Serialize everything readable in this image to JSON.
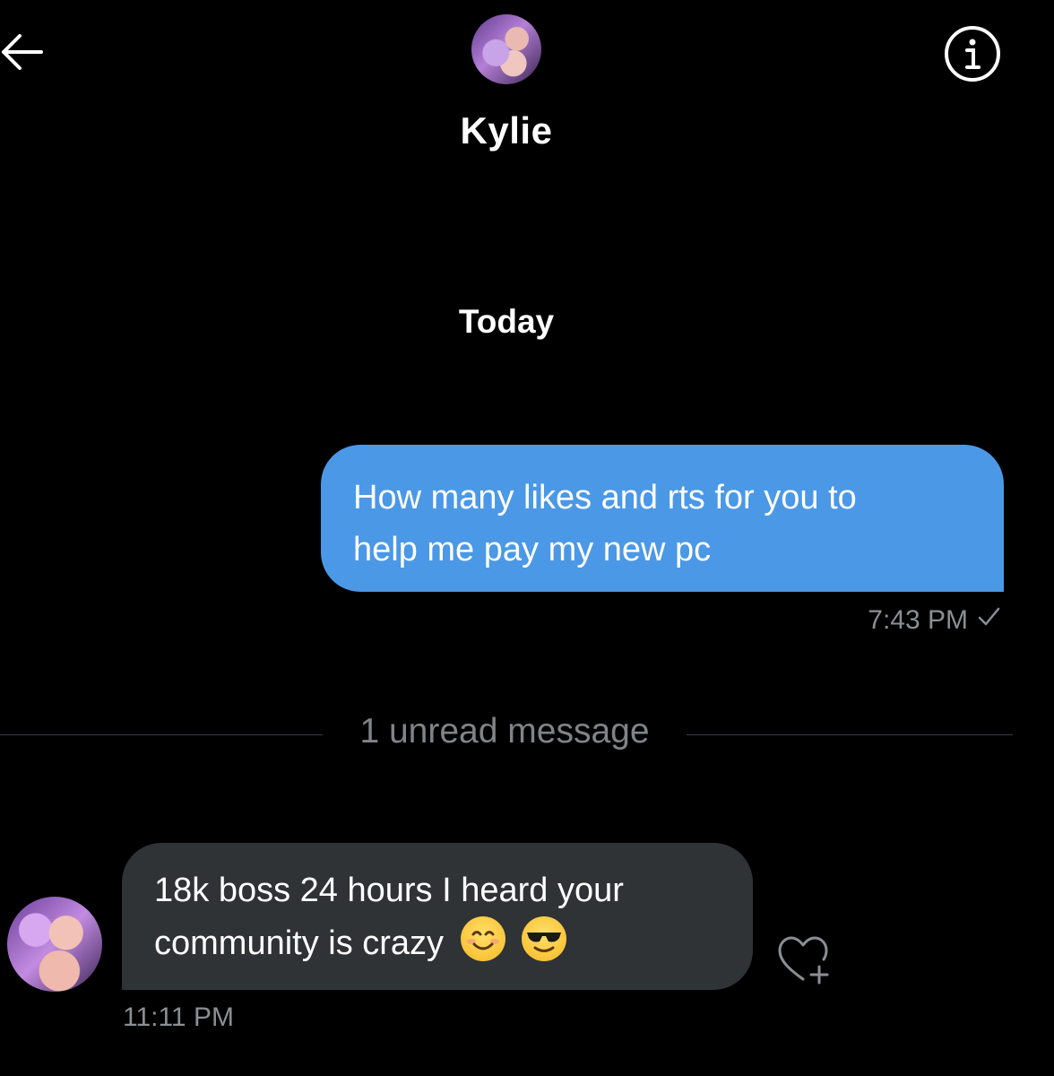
{
  "header": {
    "contact_name": "Kylie",
    "back_icon": "arrow-left-icon",
    "info_icon": "info-icon",
    "avatar": "contact-avatar"
  },
  "conversation": {
    "day_label": "Today",
    "sent_message": {
      "text_line1": "How many likes and rts for you to",
      "text_line2": "help me pay my new pc",
      "time": "7:43 PM",
      "status_icon": "check-icon"
    },
    "unread_divider": "1 unread message",
    "received_message": {
      "text_line1": "18k boss 24 hours I heard your",
      "text_line2": "community is crazy",
      "emojis": [
        "smiling-face-emoji",
        "sunglasses-face-emoji"
      ],
      "time": "11:11 PM",
      "react_icon": "heart-plus-icon"
    }
  },
  "colors": {
    "background": "#000000",
    "sent_bubble": "#4b98e6",
    "received_bubble": "#2f3336",
    "muted_text": "#8b8f93"
  }
}
